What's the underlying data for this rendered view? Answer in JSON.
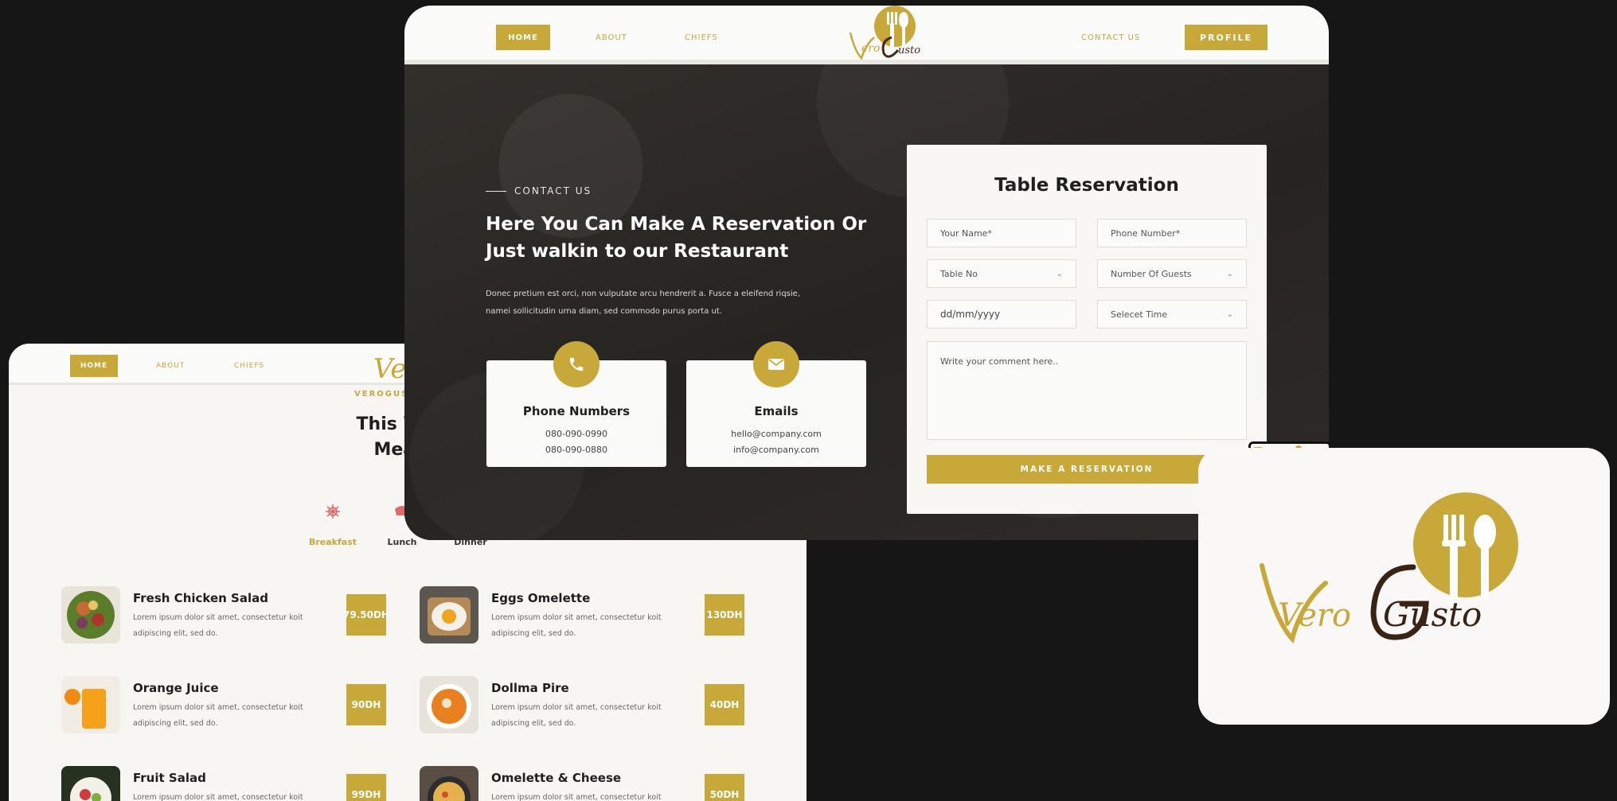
{
  "menu_card": {
    "nav": {
      "home": "HOME",
      "about": "ABOUT",
      "chiefs": "CHIEFS"
    },
    "logo_script": "Vero",
    "logo_text": "VEROGUS",
    "title_line1": "This Week",
    "title_line2": "Meal C",
    "tabs": [
      {
        "label": "Breakfast",
        "icon": "breakfast-icon"
      },
      {
        "label": "Lunch",
        "icon": "lunch-icon"
      },
      {
        "label": "Dinner",
        "icon": "dinner-icon"
      }
    ],
    "dishes": [
      {
        "name": "Fresh Chicken Salad",
        "desc": "Lorem ipsum dolor sit amet, consectetur koit adipiscing elit, sed do.",
        "price": "79.50DH"
      },
      {
        "name": "Eggs Omelette",
        "desc": "Lorem ipsum dolor sit amet, consectetur koit adipiscing elit, sed do.",
        "price": "130DH"
      },
      {
        "name": "Orange Juice",
        "desc": "Lorem ipsum dolor sit amet, consectetur koit adipiscing elit, sed do.",
        "price": "90DH"
      },
      {
        "name": "Dollma Pire",
        "desc": "Lorem ipsum dolor sit amet, consectetur koit adipiscing elit, sed do.",
        "price": "40DH"
      },
      {
        "name": "Fruit Salad",
        "desc": "Lorem ipsum dolor sit amet, consectetur koit",
        "price": "99DH"
      },
      {
        "name": "Omelette & Cheese",
        "desc": "Lorem ipsum dolor sit amet, consectetur koit",
        "price": "50DH"
      }
    ]
  },
  "reservation_card": {
    "nav": {
      "home": "HOME",
      "about": "ABOUT",
      "chiefs": "CHIEFS",
      "contact": "CONTACT US",
      "profile": "PROFILE"
    },
    "eyebrow": "CONTACT US",
    "headline_line1": "Here You Can Make A Reservation Or",
    "headline_line2": "Just walkin to our Restaurant",
    "subtext_line1": "Donec pretium est orci, non vulputate arcu hendrerit a. Fusce a eleifend riqsie,",
    "subtext_line2": "namei sollicitudin urna diam, sed commodo purus porta ut.",
    "phone_box": {
      "title": "Phone Numbers",
      "line1": "080-090-0990",
      "line2": "080-090-0880"
    },
    "email_box": {
      "title": "Emails",
      "line1": "hello@company.com",
      "line2": "info@company.com"
    },
    "form": {
      "title": "Table Reservation",
      "name_placeholder": "Your Name*",
      "phone_placeholder": "Phone Number*",
      "table_select": "Table No",
      "guests_select": "Number Of Guests",
      "date_placeholder": "dd/mm/yyyy",
      "time_select": "Selecet Time",
      "comment_placeholder": "Write your comment here..",
      "submit_label": "MAKE A RESERVATION"
    }
  },
  "brand": {
    "script_left": "Vero",
    "script_right": "Gusto"
  },
  "colors": {
    "accent": "#c9a83a",
    "dark": "#2a2826",
    "background": "#161616",
    "brown": "#3b2314"
  }
}
